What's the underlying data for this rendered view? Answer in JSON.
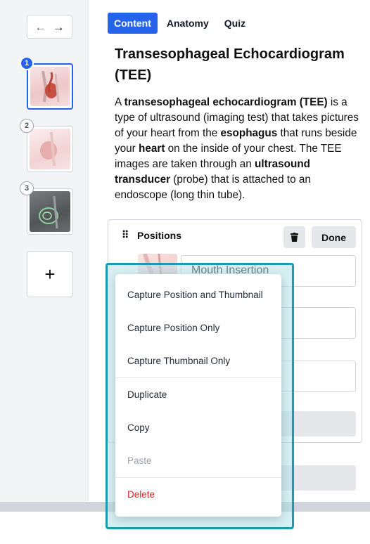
{
  "sidebar": {
    "nav_back": "←",
    "nav_forward": "→",
    "slides": [
      {
        "number": "1",
        "active": true
      },
      {
        "number": "2",
        "active": false
      },
      {
        "number": "3",
        "active": false
      }
    ],
    "add_label": "+"
  },
  "tabs": [
    {
      "label": "Content",
      "active": true
    },
    {
      "label": "Anatomy",
      "active": false
    },
    {
      "label": "Quiz",
      "active": false
    }
  ],
  "content": {
    "title": "Transesophageal Echocardiogram (TEE)",
    "description_parts": [
      {
        "text": "A ",
        "bold": false
      },
      {
        "text": "transesophageal echocardiogram (TEE)",
        "bold": true
      },
      {
        "text": " is a type of ultrasound (imaging test) that takes pictures of your heart from the ",
        "bold": false
      },
      {
        "text": "esophagus",
        "bold": true
      },
      {
        "text": " that runs beside your ",
        "bold": false
      },
      {
        "text": "heart",
        "bold": true
      },
      {
        "text": " on the inside of your chest. The TEE images are taken through an ",
        "bold": false
      },
      {
        "text": "ultrasound transducer",
        "bold": true
      },
      {
        "text": " (probe) that is attached to an endoscope (long thin tube).",
        "bold": false
      }
    ]
  },
  "positions": {
    "title": "Positions",
    "drag_handle": "⠿",
    "done_label": "Done",
    "first_position": "Mouth Insertion"
  },
  "context_menu": {
    "items": [
      {
        "label": "Capture Position and Thumbnail",
        "state": "normal"
      },
      {
        "label": "Capture Position Only",
        "state": "normal"
      },
      {
        "label": "Capture Thumbnail Only",
        "state": "normal"
      },
      {
        "separator": true
      },
      {
        "label": "Duplicate",
        "state": "normal"
      },
      {
        "label": "Copy",
        "state": "normal"
      },
      {
        "label": "Paste",
        "state": "disabled"
      },
      {
        "separator": true
      },
      {
        "label": "Delete",
        "state": "danger"
      }
    ]
  },
  "colors": {
    "accent": "#2563eb",
    "highlight_frame": "#1e9ab0",
    "danger": "#dc2626"
  }
}
